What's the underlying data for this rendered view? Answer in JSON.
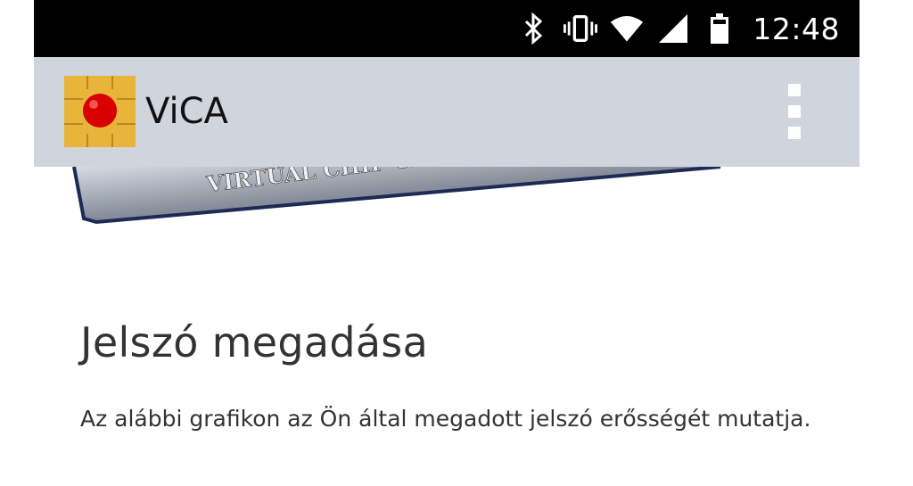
{
  "status_bar": {
    "icons": [
      "bluetooth-icon",
      "vibrate-icon",
      "wifi-icon",
      "cell-signal-icon",
      "battery-icon"
    ],
    "time": "12:48"
  },
  "app_bar": {
    "title": "ViCA",
    "logo_icon": "chip-logo-icon",
    "menu_icon": "overflow-menu-icon"
  },
  "banner": {
    "card_text": "VIRTUAL CHIP CA"
  },
  "content": {
    "heading": "Jelszó megadása",
    "description": "Az alábbi grafikon az Ön által megadott jelszó erősségét mutatja."
  },
  "colors": {
    "status_bar": "#000000",
    "app_bar": "#cfd4dd",
    "logo_gold": "#e8b53a",
    "logo_red": "#d80000",
    "text": "#333333"
  }
}
